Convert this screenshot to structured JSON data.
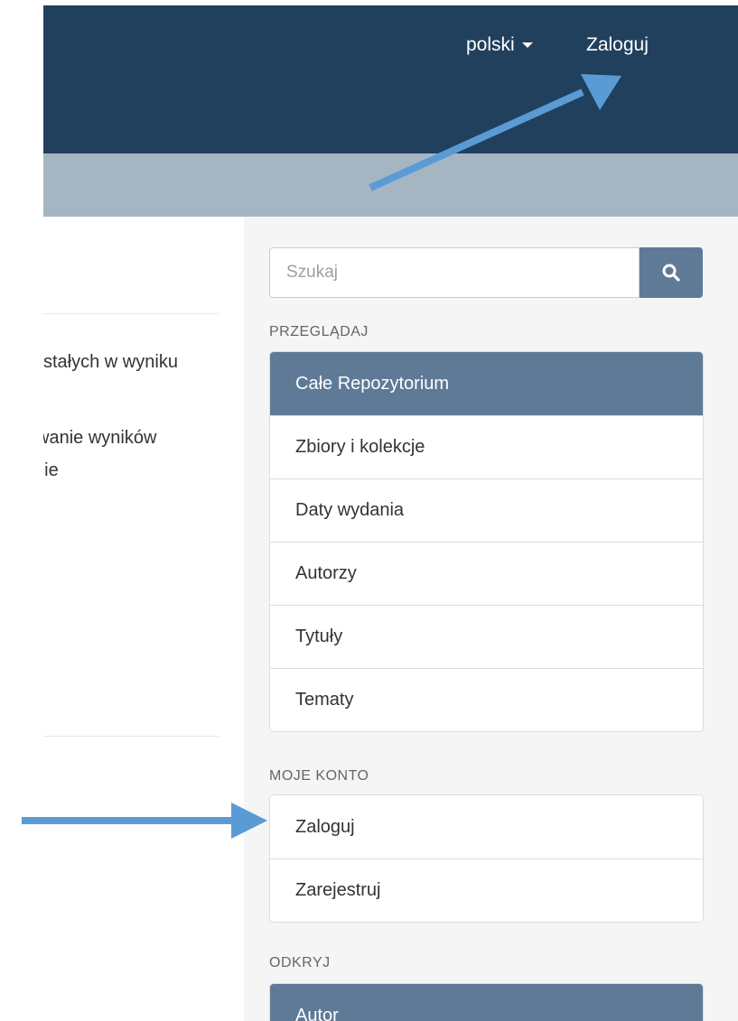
{
  "navbar": {
    "language_label": "polski",
    "login_label": "Zaloguj"
  },
  "content": {
    "line1": "stałych w wyniku",
    "line2": "wanie wyników",
    "line3": "nie"
  },
  "search": {
    "placeholder": "Szukaj",
    "value": ""
  },
  "browse": {
    "heading": "PRZEGLĄDAJ",
    "items": [
      {
        "label": "Całe Repozytorium",
        "active": true
      },
      {
        "label": "Zbiory i kolekcje"
      },
      {
        "label": "Daty wydania"
      },
      {
        "label": "Autorzy"
      },
      {
        "label": "Tytuły"
      },
      {
        "label": "Tematy"
      }
    ]
  },
  "account": {
    "heading": "MOJE KONTO",
    "items": [
      {
        "label": "Zaloguj"
      },
      {
        "label": "Zarejestruj"
      }
    ]
  },
  "discover": {
    "heading": "ODKRYJ",
    "items": [
      {
        "label": "Autor",
        "active": true
      }
    ]
  },
  "colors": {
    "navbar": "#21405d",
    "trail": "#a6b5c2",
    "accent": "#5f7a96",
    "annotation_arrow": "#5b9bd5"
  },
  "icons": {
    "search": "search-icon",
    "caret": "caret-down-icon",
    "arrow": "annotation-arrow"
  }
}
